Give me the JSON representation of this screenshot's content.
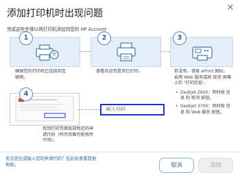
{
  "dialog": {
    "title": "添加打印机时出现问题",
    "close_glyph": "✕",
    "subtitle": "完成这些步骤以将打印机添加到您的 HP Account"
  },
  "steps": [
    {
      "number": "1",
      "text_lines": [
        "确保您的打印机已连接到互",
        "联网。"
      ],
      "icon": "wifi-printer-icon"
    },
    {
      "number": "2",
      "text_lines": [
        "查看欢迎页是否已打印。"
      ],
      "icon": "printer-output-icon"
    },
    {
      "number": "3",
      "text_lines": [
        "若没有，请按 ePrint 图标。",
        "启用 Web 服务或按 接受 屏幕",
        "上的 '打印信息'。"
      ],
      "icon": "printer-panel-icon"
    },
    {
      "number": "4",
      "text_lines": [
        "找到打印页面底部附近的申",
        "请代码（所示页面可能有所",
        "不同）。"
      ],
      "icon": "printed-page-icon"
    }
  ],
  "step3_bullets": [
    {
      "lines": [
        "Deskjet 2600：同时按 信",
        "息 和 取消 按钮。"
      ]
    },
    {
      "lines": [
        "Deskjet 3700：同时按 信",
        "息 和 Web 服务 按钮。"
      ]
    }
  ],
  "code_input": {
    "placeholder": "输入代码",
    "value": ""
  },
  "footer": {
    "help_link_lines": [
      "无法定位或输入您的申请代码？在此处查看其他",
      "帮助。"
    ],
    "cancel_label": "取消",
    "add_label": "添加"
  },
  "colors": {
    "accent": "#2a6aa8",
    "highlight_border": "#1a2fd0",
    "card_fill": "#e3eef8"
  }
}
